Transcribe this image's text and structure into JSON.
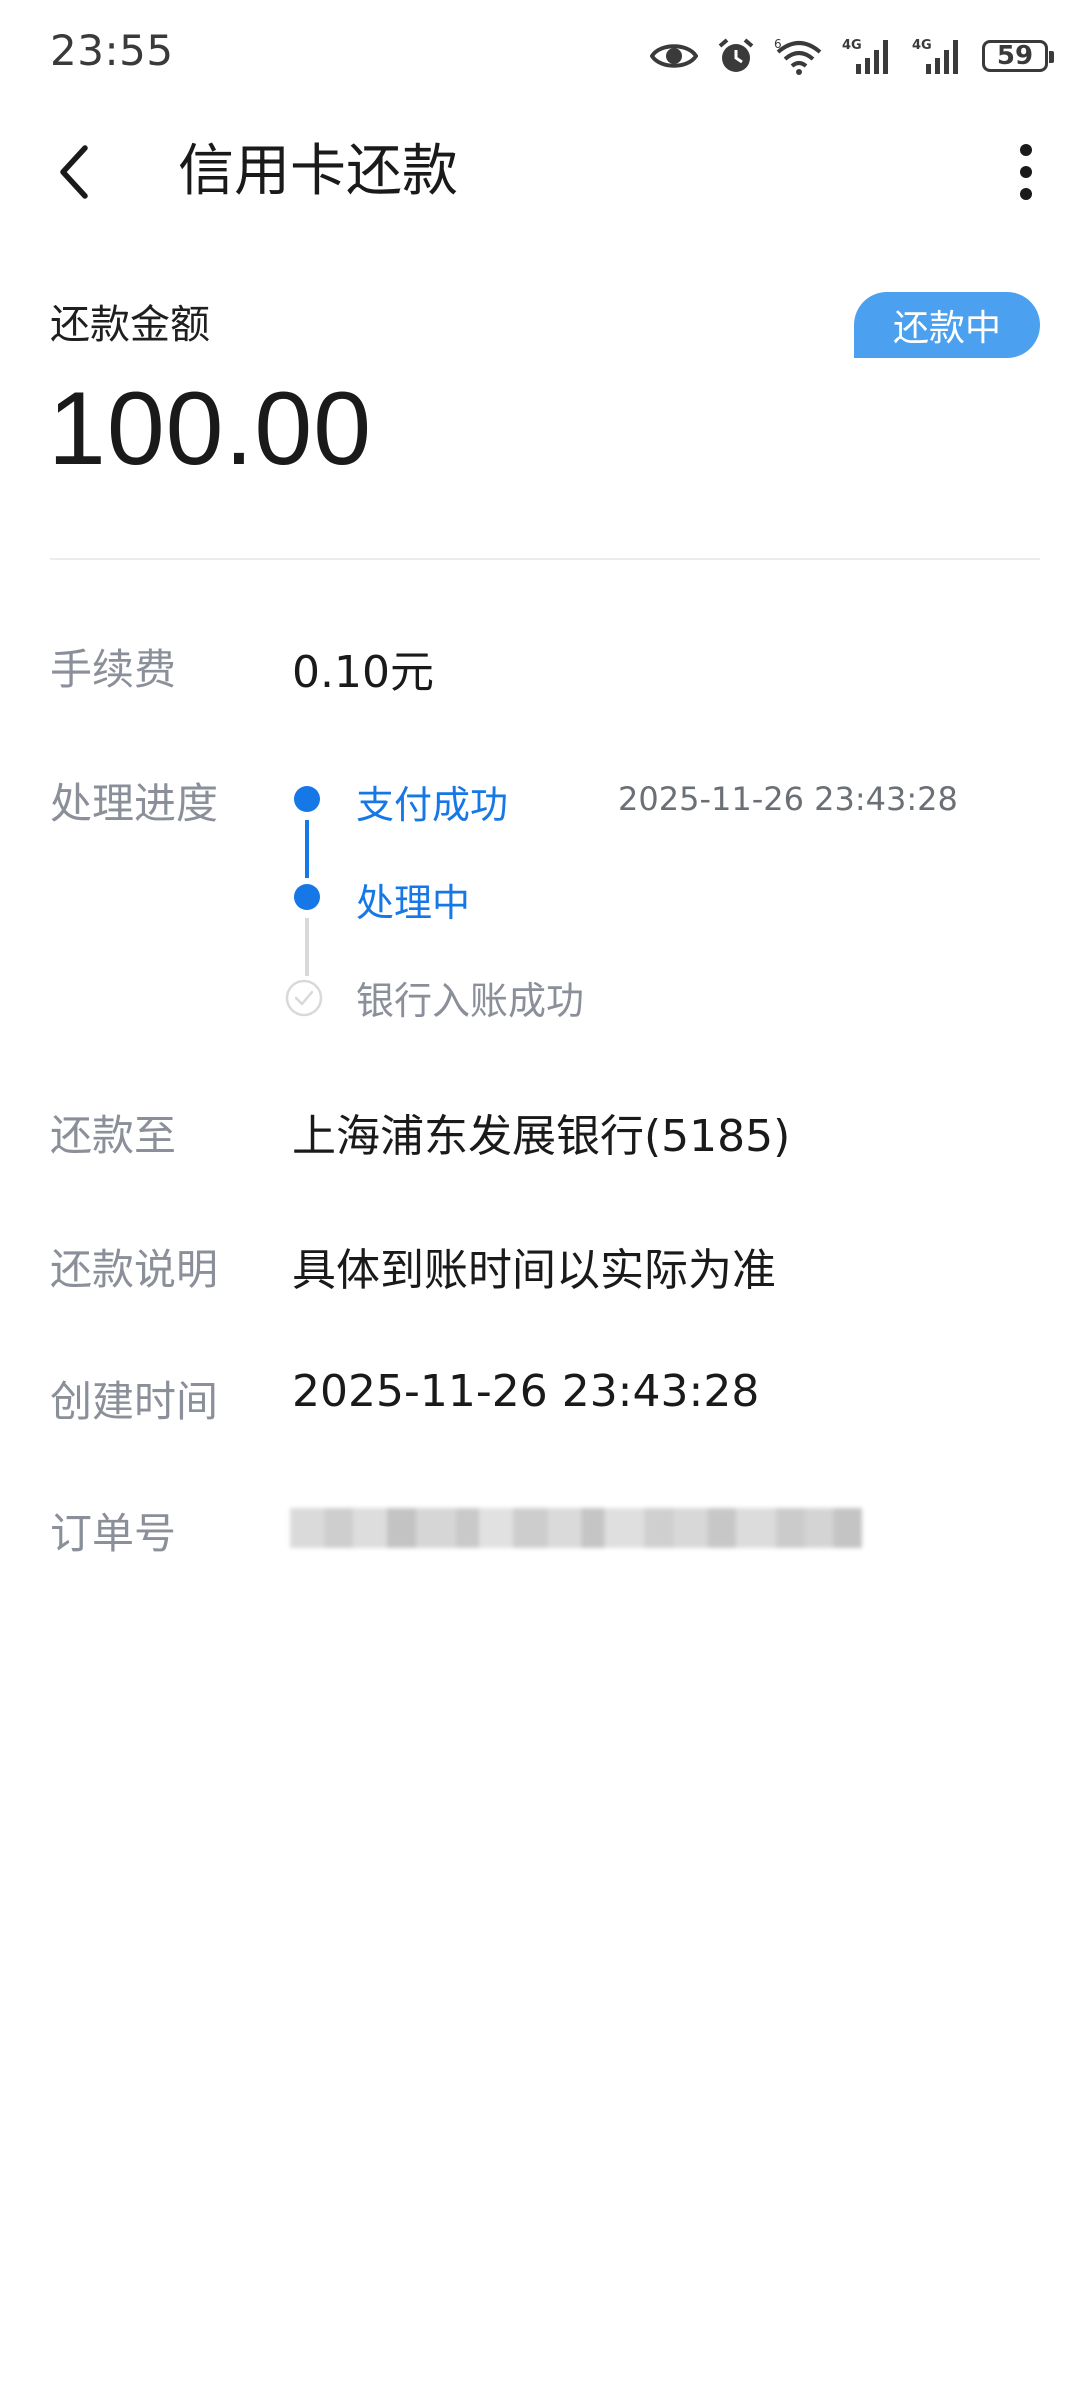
{
  "status_bar": {
    "time": "23:55",
    "icons": [
      "eye-icon",
      "alarm-icon",
      "wifi-6-icon",
      "signal-4g-icon",
      "signal-4g-icon"
    ],
    "wifi_label": "6",
    "network_label_1": "4G",
    "network_label_2": "4G",
    "battery": "59"
  },
  "header": {
    "title": "信用卡还款",
    "back_icon": "chevron-left-icon",
    "more_icon": "more-vertical-icon"
  },
  "amount": {
    "label": "还款金额",
    "value": "100.00",
    "status": "还款中"
  },
  "details": {
    "fee_label": "手续费",
    "fee_value": "0.10元",
    "progress_label": "处理进度",
    "progress_steps": [
      {
        "label": "支付成功",
        "time": "2025-11-26 23:43:28",
        "state": "done"
      },
      {
        "label": "处理中",
        "state": "active"
      },
      {
        "label": "银行入账成功",
        "state": "pending"
      }
    ],
    "repay_to_label": "还款至",
    "repay_to_value": "上海浦东发展银行(5185)",
    "note_label": "还款说明",
    "note_value": "具体到账时间以实际为准",
    "created_label": "创建时间",
    "created_value": "2025-11-26 23:43:28",
    "order_label": "订单号"
  },
  "colors": {
    "accent": "#1677e6",
    "badge": "#4ba0f0",
    "label_grey": "#8a8f99",
    "pending_grey": "#d9d9d9"
  }
}
